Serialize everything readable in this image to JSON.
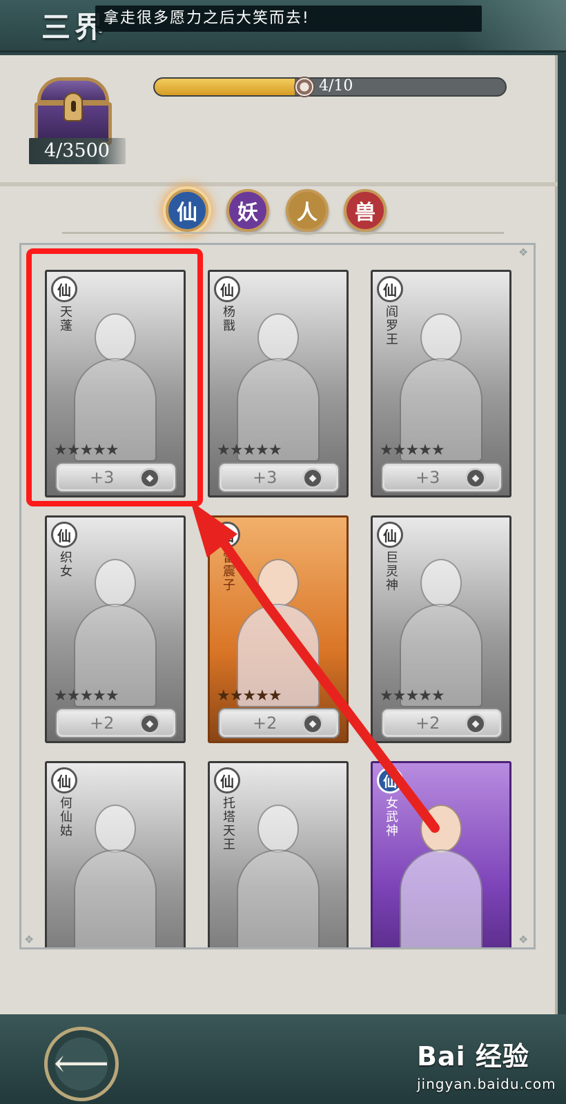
{
  "header": {
    "game_title": "三界",
    "marquee_text": "拿走很多愿力之后大笑而去!"
  },
  "chest": {
    "count": "4/3500"
  },
  "progress": {
    "text": "4/10",
    "fraction": 0.4
  },
  "tabs": [
    {
      "label": "仙",
      "color": "#2c5aa0",
      "active": true
    },
    {
      "label": "妖",
      "color": "#6b3a98",
      "active": false
    },
    {
      "label": "人",
      "color": "#b88b3f",
      "active": false
    },
    {
      "label": "兽",
      "color": "#b3353a",
      "active": false
    }
  ],
  "cards": [
    {
      "badge": "仙",
      "name": "天蓬",
      "stars": "★★★★★",
      "bonus": "+3",
      "style": "gray",
      "highlighted": true
    },
    {
      "badge": "仙",
      "name": "杨戬",
      "stars": "★★★★★",
      "bonus": "+3",
      "style": "gray"
    },
    {
      "badge": "仙",
      "name": "阎罗王",
      "stars": "★★★★★",
      "bonus": "+3",
      "style": "gray"
    },
    {
      "badge": "仙",
      "name": "织女",
      "stars": "★★★★★",
      "bonus": "+2",
      "style": "gray"
    },
    {
      "badge": "仙",
      "name": "雷震子",
      "stars": "★★★★★",
      "bonus": "+2",
      "style": "orange"
    },
    {
      "badge": "仙",
      "name": "巨灵神",
      "stars": "★★★★★",
      "bonus": "+2",
      "style": "gray"
    },
    {
      "badge": "仙",
      "name": "何仙姑",
      "style": "gray"
    },
    {
      "badge": "仙",
      "name": "托塔天王",
      "style": "gray"
    },
    {
      "badge": "仙",
      "name": "女武神",
      "style": "purple"
    }
  ],
  "annotation": {
    "box_color": "#ff1a1a",
    "arrow_color": "#e8231f"
  },
  "footer": {
    "back_icon": "back-arrow-icon",
    "watermark_main": "Bai 经验",
    "watermark_sub": "jingyan.baidu.com"
  }
}
